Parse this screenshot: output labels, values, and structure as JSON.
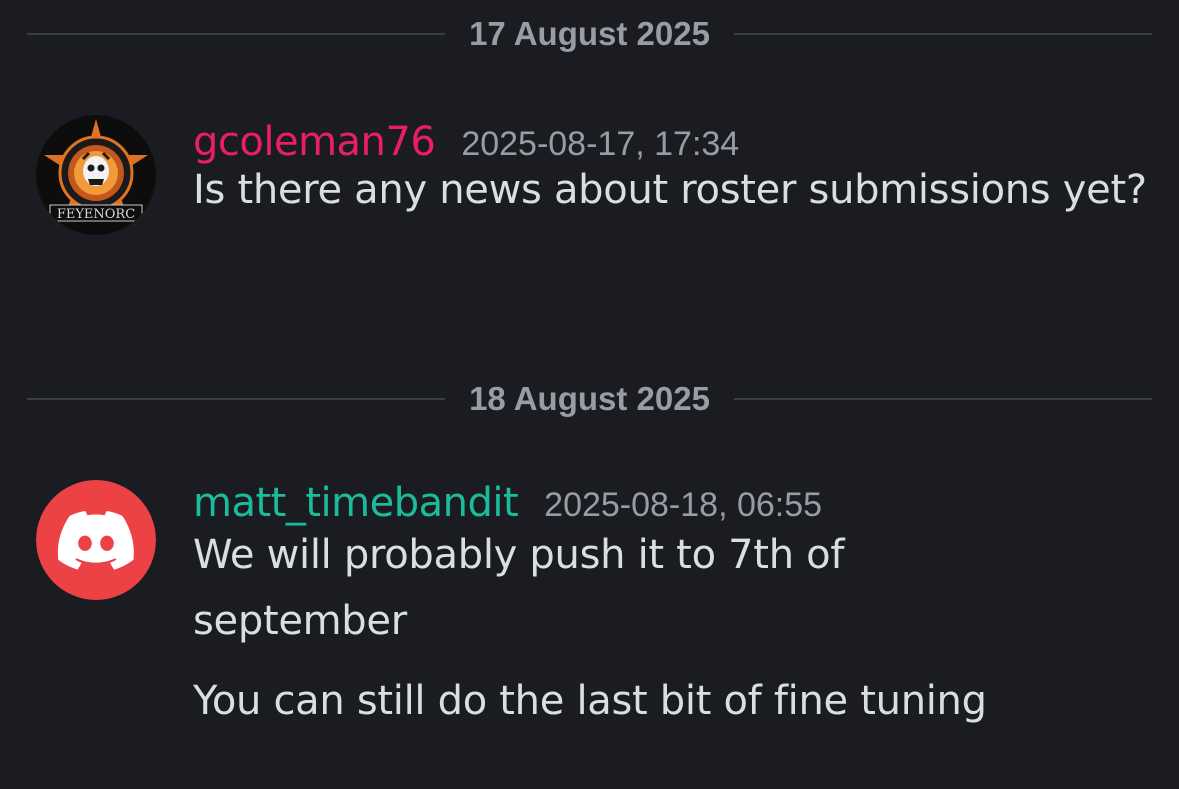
{
  "dividers": [
    {
      "date": "17 August 2025"
    },
    {
      "date": "18 August 2025"
    }
  ],
  "messages": [
    {
      "avatar_icon": "feyenorc-logo-icon",
      "avatar_text": "FEYENORC",
      "username": "gcoleman76",
      "username_color": "#e91e63",
      "timestamp": "2025-08-17, 17:34",
      "lines": [
        "Is there any news about roster submissions yet?"
      ]
    },
    {
      "avatar_icon": "discord-logo-icon",
      "avatar_color": "#ed4245",
      "username": "matt_timebandit",
      "username_color": "#1abc9c",
      "timestamp": "2025-08-18, 06:55",
      "lines": [
        "We will probably push it to 7th of september",
        "You can still do the last bit of fine tuning"
      ]
    }
  ]
}
